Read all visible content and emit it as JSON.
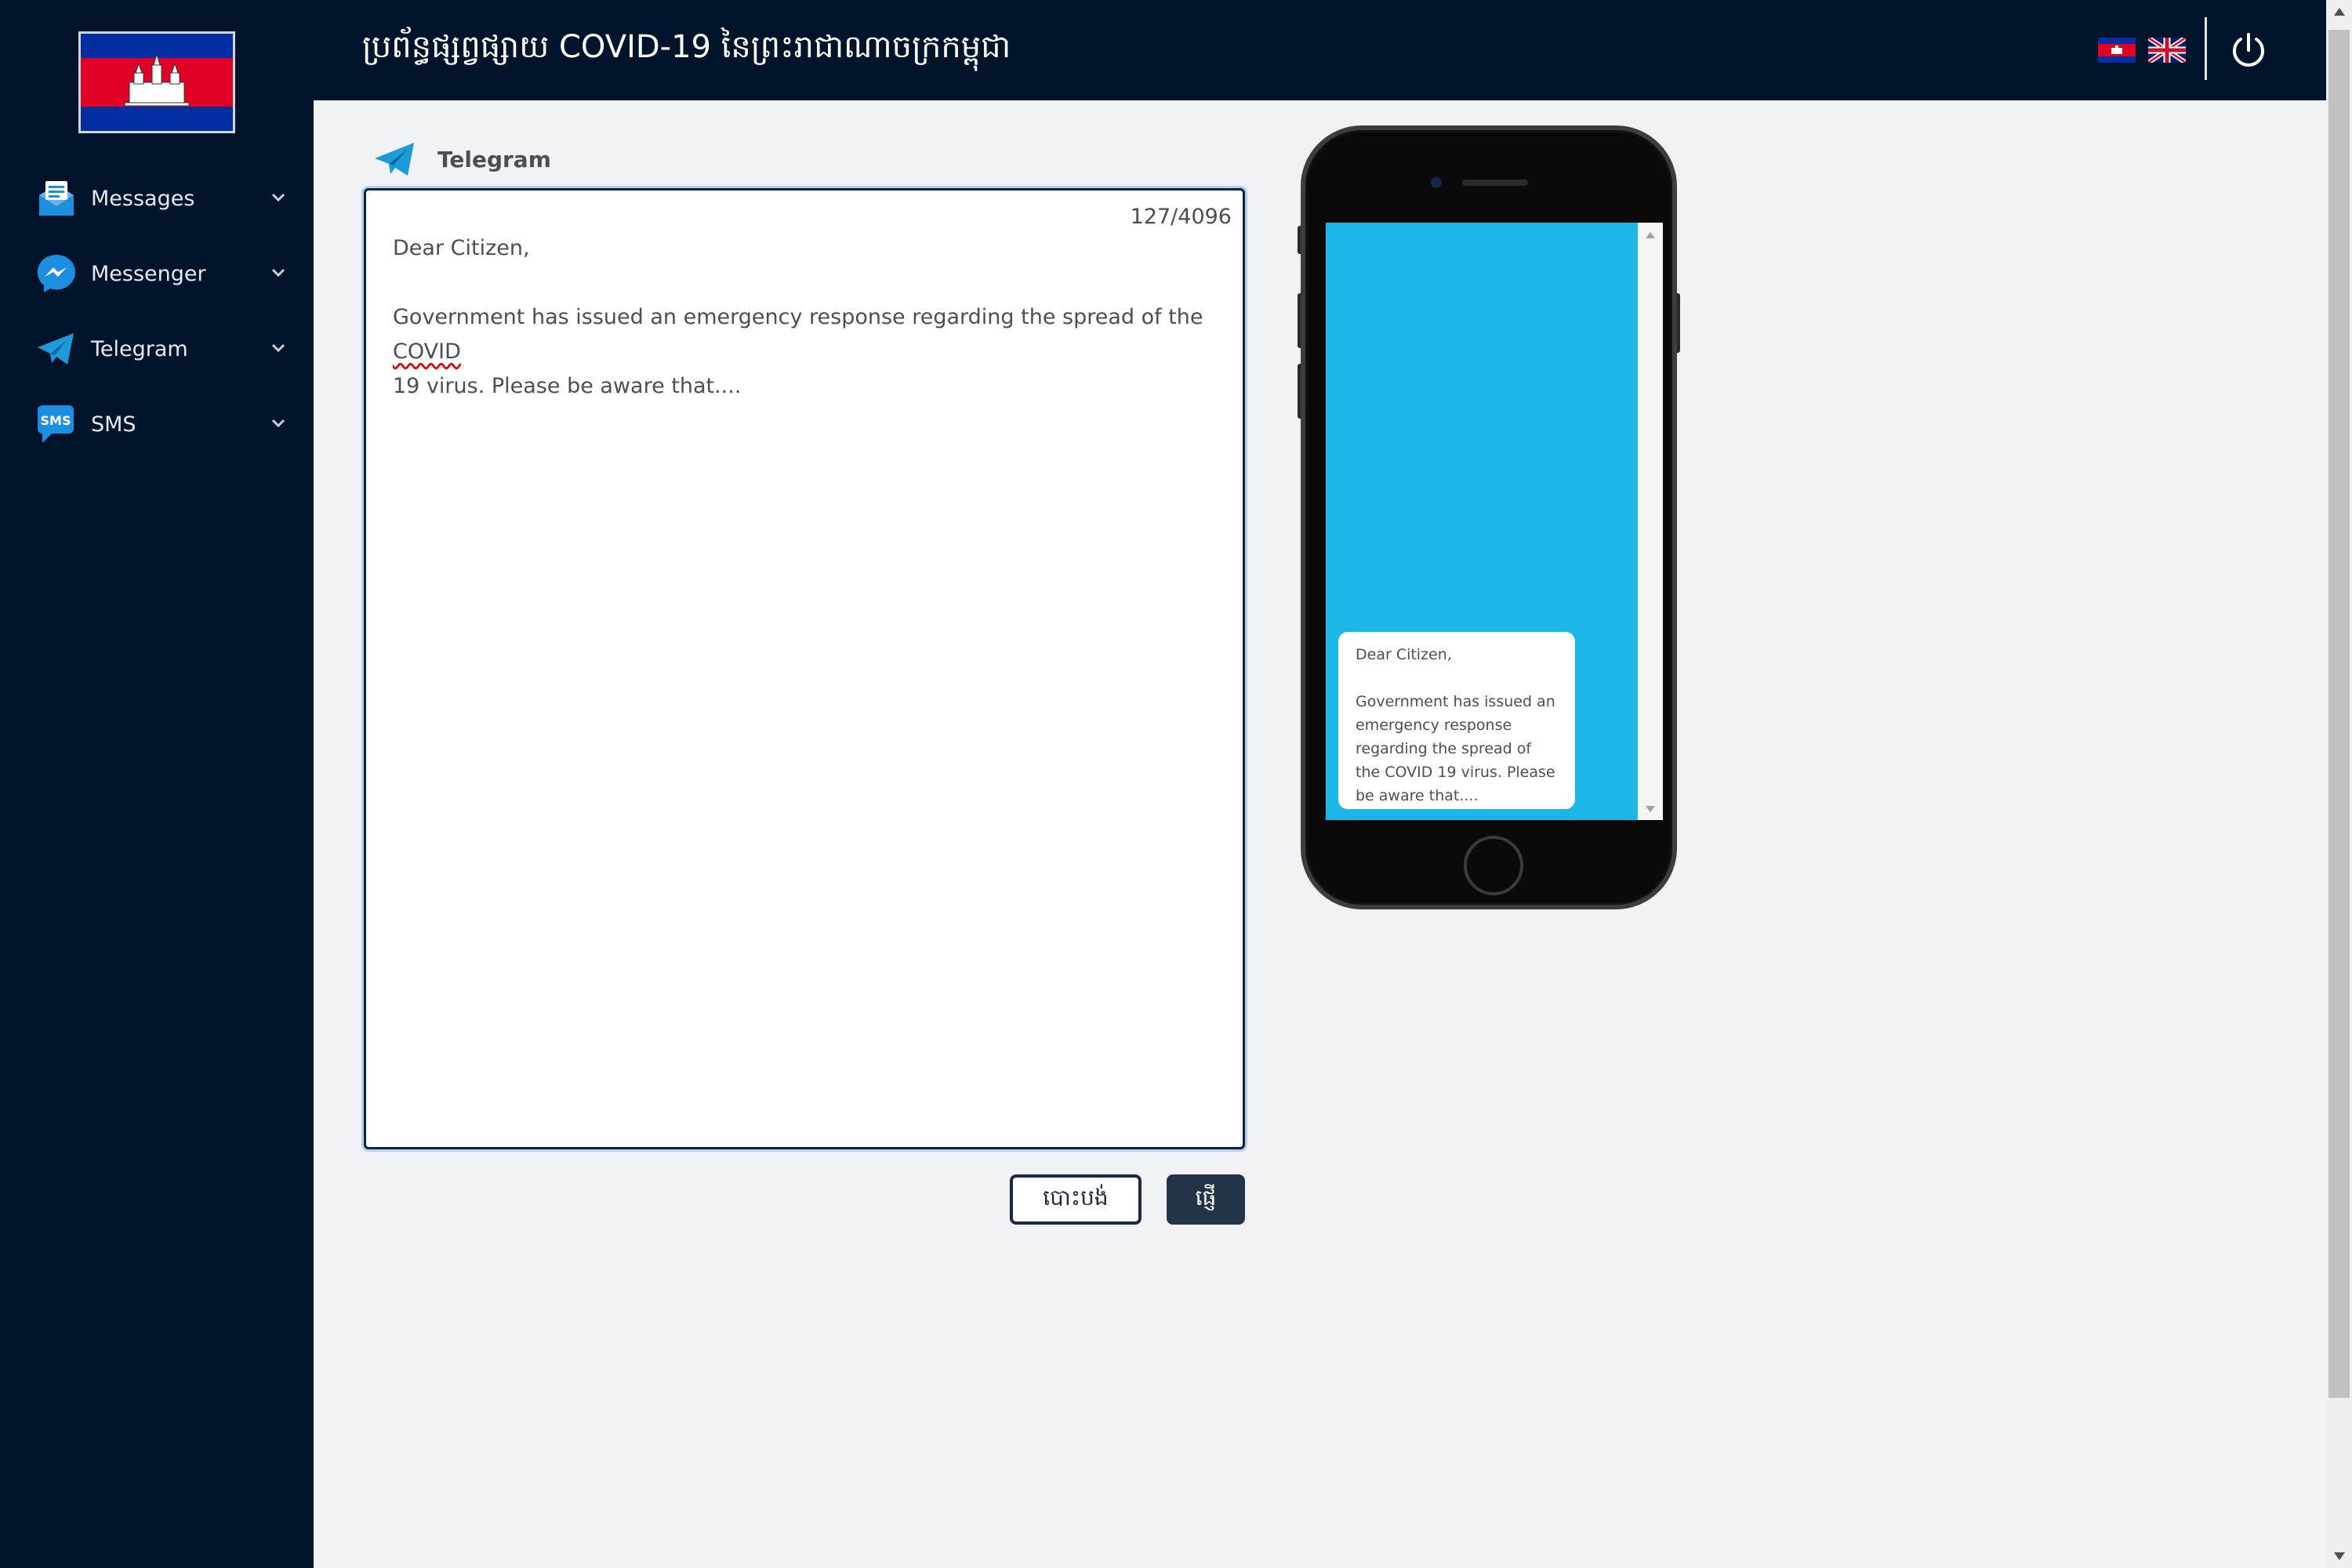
{
  "app": {
    "title": "ប្រព័ន្ធផ្សព្វផ្សាយ COVID-19 នៃព្រះរាជាណាចក្រកម្ពុជា"
  },
  "sidebar": {
    "items": [
      {
        "label": "Messages",
        "icon": "envelope-message-icon"
      },
      {
        "label": "Messenger",
        "icon": "messenger-icon"
      },
      {
        "label": "Telegram",
        "icon": "telegram-icon"
      },
      {
        "label": "SMS",
        "icon": "sms-icon",
        "icon_text": "SMS"
      }
    ]
  },
  "header": {
    "language_khmer_icon": "cambodia-flag-icon",
    "language_english_icon": "uk-flag-icon",
    "power_icon": "power-icon"
  },
  "main": {
    "section_title": "Telegram",
    "editor": {
      "counter": "127/4096",
      "line1": "Dear Citizen,",
      "line2_pre": "Government has issued an emergency response regarding the spread of the ",
      "line2_misspelled": "COVID",
      "line2_post": "\n19 virus. Please be aware that...."
    },
    "buttons": {
      "cancel": "បោះបង់",
      "send": "ផ្ញើ"
    }
  },
  "preview": {
    "message": "Dear Citizen,\n\nGovernment has issued an emergency response regarding the spread of the COVID 19 virus. Please be aware that...."
  },
  "colors": {
    "sidebar_bg": "#01142b",
    "page_bg": "#f0f2f6",
    "telegram_blue": "#1d9bd9",
    "phone_screen": "#1cb6e9",
    "send_button": "#233449"
  }
}
